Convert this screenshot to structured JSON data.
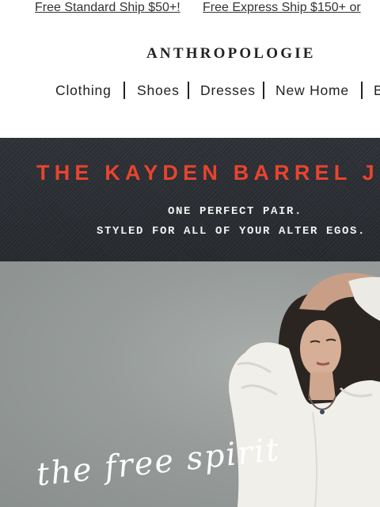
{
  "promo": {
    "standard": "Free Standard Ship $50+!",
    "express": "Free Express Ship $150+ or"
  },
  "brand": {
    "logo_text": "ANTHROPOLOGIE"
  },
  "nav": {
    "items": [
      "Clothing",
      "Shoes",
      "Dresses",
      "New Home",
      "B"
    ]
  },
  "banner": {
    "headline": "THE KAYDEN BARREL J",
    "line1": "ONE PERFECT PAIR.",
    "line2": "STYLED FOR ALL OF YOUR ALTER EGOS."
  },
  "hero": {
    "script_text": "the free spirit"
  },
  "colors": {
    "headline_red": "#e8442f",
    "denim": "#2c2f34",
    "hero_bg": "#979c9b"
  }
}
